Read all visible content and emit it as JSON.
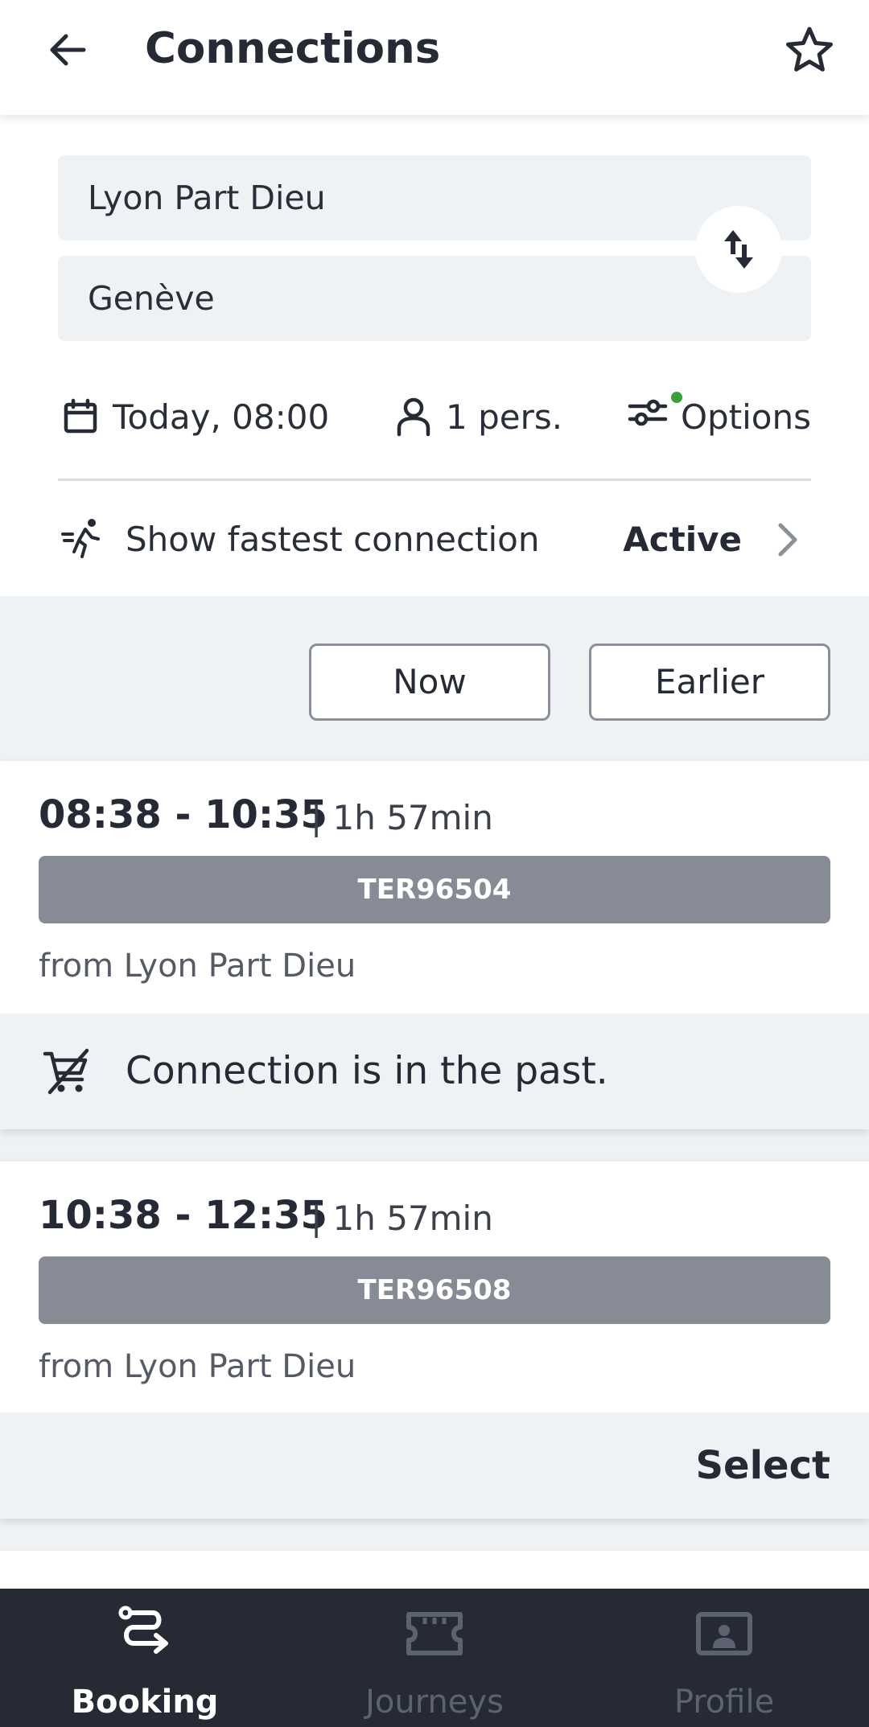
{
  "header": {
    "title": "Connections",
    "back_icon": "arrow-left-icon",
    "favorite_icon": "star-icon"
  },
  "search": {
    "from": "Lyon Part Dieu",
    "to": "Genève",
    "swap_icon": "swap-vertical-icon",
    "date": "Today, 08:00",
    "passengers": "1 pers.",
    "options": "Options",
    "options_indicator_color": "#3aa03a",
    "fastest_label": "Show fastest connection",
    "fastest_state": "Active"
  },
  "time_nav": {
    "now": "Now",
    "earlier": "Earlier"
  },
  "connections": [
    {
      "times": "08:38 - 10:35",
      "duration": "| 1h 57min",
      "train": "TER96504",
      "origin": "from Lyon Part Dieu",
      "status": "Connection is in the past."
    },
    {
      "times": "10:38 - 12:35",
      "duration": "| 1h 57min",
      "train": "TER96508",
      "origin": "from Lyon Part Dieu",
      "action": "Select"
    }
  ],
  "nav": {
    "items": [
      {
        "label": "Booking",
        "icon": "route-icon",
        "active": true
      },
      {
        "label": "Journeys",
        "icon": "ticket-icon",
        "active": false
      },
      {
        "label": "Profile",
        "icon": "profile-card-icon",
        "active": false
      }
    ]
  },
  "colors": {
    "dark": "#262a35",
    "train_badge": "#878b95",
    "panel_bg": "#eff2f5"
  }
}
